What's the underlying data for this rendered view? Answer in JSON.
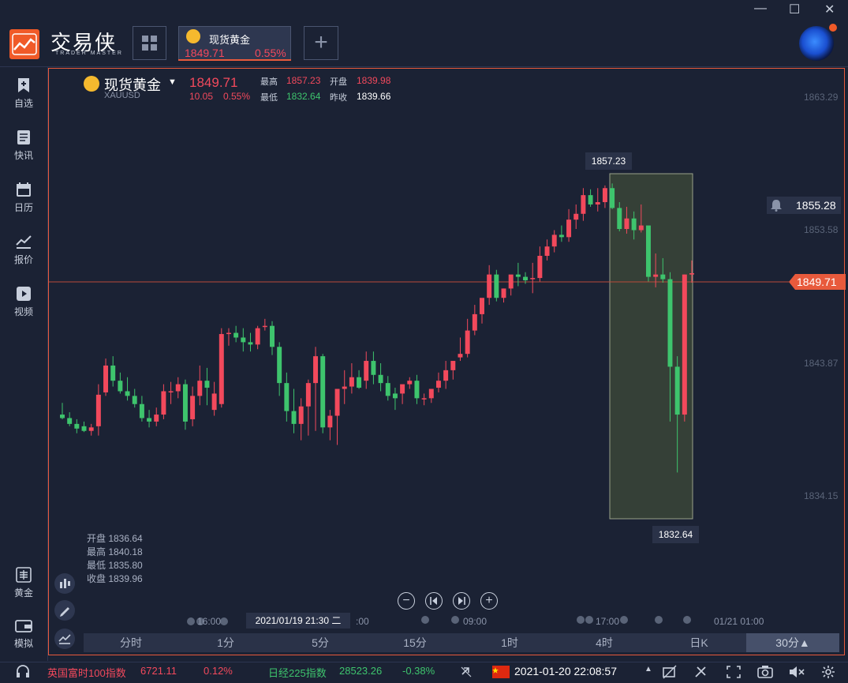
{
  "app": {
    "name": "交易侠",
    "sub": "TRADER MASTER"
  },
  "tab": {
    "name": "现货黄金",
    "price": "1849.71",
    "pct": "0.55%"
  },
  "window_controls": [
    "—",
    "☐",
    "✕"
  ],
  "sidebar": [
    {
      "label": "自选",
      "icon": "bookmark-plus-icon"
    },
    {
      "label": "快讯",
      "icon": "news-icon"
    },
    {
      "label": "日历",
      "icon": "calendar-icon"
    },
    {
      "label": "报价",
      "icon": "quote-chart-icon"
    },
    {
      "label": "视频",
      "icon": "video-icon"
    },
    {
      "label": "黄金",
      "icon": "gold-icon"
    },
    {
      "label": "模拟",
      "icon": "wallet-icon"
    }
  ],
  "symbol": {
    "name": "现货黄金",
    "code": "XAUUSD",
    "price": "1849.71",
    "change": "10.05",
    "pct": "0.55%",
    "high_label": "最高",
    "high": "1857.23",
    "open_label": "开盘",
    "open": "1839.98",
    "low_label": "最低",
    "low": "1832.64",
    "prev_label": "昨收",
    "prev": "1839.66"
  },
  "ohlc_box": {
    "open": "开盘 1836.64",
    "high": "最高 1840.18",
    "low": "最低 1835.80",
    "close": "收盘 1839.96"
  },
  "price_axis": [
    "1863.29",
    "1853.58",
    "1843.87",
    "1834.15"
  ],
  "alert_price": "1855.28",
  "current_price": "1849.71",
  "range_high": "1857.23",
  "range_low": "1832.64",
  "time_labels": {
    "t1": "16:00",
    "cursor": "2021/01/19 21:30 二",
    "t2": ":00",
    "t3": "09:00",
    "t4": "17:00",
    "t5": "01/21 01:00"
  },
  "timeframes": [
    "分时",
    "1分",
    "5分",
    "15分",
    "1时",
    "4时",
    "日K",
    "30分▲"
  ],
  "active_timeframe": "30分▲",
  "status": {
    "idx1_name": "英国富时100指数",
    "idx1_val": "6721.11",
    "idx1_pct": "0.12%",
    "idx2_name": "日经225指数",
    "idx2_val": "28523.26",
    "idx2_pct": "-0.38%",
    "datetime": "2021-01-20 22:08:57"
  },
  "colors": {
    "up": "#f2495c",
    "down": "#3ec46d",
    "accent": "#e85a3c",
    "bg": "#1b2234"
  },
  "chart_data": {
    "type": "candlestick",
    "ylim": [
      1830.5,
      1865.0
    ],
    "candles": [
      [
        1837.6,
        1838.6,
        1837.2,
        1837.3
      ],
      [
        1837.3,
        1837.8,
        1836.6,
        1836.8
      ],
      [
        1836.8,
        1837.2,
        1836.0,
        1836.4
      ],
      [
        1836.6,
        1837.0,
        1836.1,
        1836.2
      ],
      [
        1836.2,
        1836.8,
        1835.8,
        1836.5
      ],
      [
        1836.6,
        1840.2,
        1835.8,
        1839.3
      ],
      [
        1839.5,
        1842.4,
        1839.2,
        1841.8
      ],
      [
        1841.8,
        1842.6,
        1840.0,
        1840.5
      ],
      [
        1840.5,
        1841.2,
        1839.4,
        1839.6
      ],
      [
        1839.6,
        1840.8,
        1838.8,
        1839.2
      ],
      [
        1839.2,
        1839.8,
        1838.2,
        1838.5
      ],
      [
        1838.5,
        1839.2,
        1837.0,
        1837.3
      ],
      [
        1837.3,
        1838.0,
        1836.5,
        1837.0
      ],
      [
        1837.0,
        1838.2,
        1836.6,
        1837.6
      ],
      [
        1837.6,
        1840.2,
        1837.2,
        1839.6
      ],
      [
        1839.6,
        1840.4,
        1838.5,
        1839.6
      ],
      [
        1839.6,
        1840.8,
        1839.0,
        1840.2
      ],
      [
        1840.2,
        1840.6,
        1836.3,
        1837.0
      ],
      [
        1837.2,
        1840.0,
        1836.6,
        1839.2
      ],
      [
        1839.2,
        1841.8,
        1838.4,
        1840.5
      ],
      [
        1840.5,
        1841.6,
        1838.4,
        1839.9
      ],
      [
        1838.0,
        1840.4,
        1837.5,
        1839.4
      ],
      [
        1838.5,
        1845.0,
        1838.2,
        1844.5
      ],
      [
        1844.5,
        1845.0,
        1843.5,
        1844.6
      ],
      [
        1844.6,
        1845.2,
        1843.8,
        1844.2
      ],
      [
        1844.2,
        1845.0,
        1843.0,
        1843.8
      ],
      [
        1843.8,
        1844.6,
        1843.0,
        1843.6
      ],
      [
        1843.6,
        1845.2,
        1843.2,
        1845.0
      ],
      [
        1845.2,
        1845.8,
        1844.8,
        1845.2
      ],
      [
        1845.2,
        1845.6,
        1842.7,
        1843.4
      ],
      [
        1843.4,
        1843.8,
        1839.2,
        1840.3
      ],
      [
        1840.3,
        1841.2,
        1837.0,
        1837.9
      ],
      [
        1837.9,
        1839.8,
        1836.0,
        1836.8
      ],
      [
        1836.8,
        1839.0,
        1835.4,
        1838.3
      ],
      [
        1838.3,
        1840.6,
        1835.8,
        1840.3
      ],
      [
        1840.3,
        1843.4,
        1836.2,
        1842.6
      ],
      [
        1842.6,
        1842.8,
        1836.0,
        1836.5
      ],
      [
        1836.5,
        1838.0,
        1835.4,
        1837.5
      ],
      [
        1837.5,
        1839.6,
        1835.0,
        1839.8
      ],
      [
        1839.8,
        1841.4,
        1838.5,
        1840.0
      ],
      [
        1840.0,
        1842.0,
        1839.4,
        1840.8
      ],
      [
        1840.8,
        1841.4,
        1839.8,
        1839.9
      ],
      [
        1840.5,
        1843.0,
        1839.8,
        1842.2
      ],
      [
        1842.2,
        1843.0,
        1840.2,
        1841.0
      ],
      [
        1841.0,
        1842.0,
        1839.6,
        1840.3
      ],
      [
        1840.3,
        1840.9,
        1838.8,
        1839.2
      ],
      [
        1839.4,
        1839.9,
        1838.0,
        1839.0
      ],
      [
        1839.4,
        1840.0,
        1838.5,
        1840.2
      ],
      [
        1840.2,
        1840.8,
        1839.8,
        1840.5
      ],
      [
        1840.5,
        1841.0,
        1838.5,
        1839.0
      ],
      [
        1839.0,
        1839.4,
        1838.4,
        1839.0
      ],
      [
        1839.0,
        1839.8,
        1838.6,
        1839.8
      ],
      [
        1839.9,
        1841.2,
        1839.5,
        1840.5
      ],
      [
        1840.5,
        1842.2,
        1839.8,
        1841.4
      ],
      [
        1841.4,
        1842.0,
        1840.6,
        1842.2
      ],
      [
        1842.5,
        1844.2,
        1842.2,
        1842.8
      ],
      [
        1842.8,
        1845.8,
        1842.5,
        1844.8
      ],
      [
        1844.8,
        1847.0,
        1844.4,
        1846.2
      ],
      [
        1846.2,
        1847.2,
        1845.4,
        1847.6
      ],
      [
        1847.6,
        1850.4,
        1847.0,
        1849.6
      ],
      [
        1849.6,
        1850.0,
        1847.3,
        1847.6
      ],
      [
        1847.6,
        1848.4,
        1847.2,
        1848.4
      ],
      [
        1848.4,
        1849.4,
        1847.8,
        1849.6
      ],
      [
        1849.6,
        1850.6,
        1848.6,
        1849.4
      ],
      [
        1849.4,
        1849.8,
        1848.8,
        1849.1
      ],
      [
        1849.2,
        1850.6,
        1848.0,
        1849.3
      ],
      [
        1849.3,
        1852.0,
        1849.0,
        1851.2
      ],
      [
        1851.2,
        1852.6,
        1850.8,
        1852.0
      ],
      [
        1852.0,
        1853.4,
        1851.5,
        1853.0
      ],
      [
        1853.0,
        1853.8,
        1852.4,
        1852.8
      ],
      [
        1852.8,
        1855.2,
        1852.4,
        1854.3
      ],
      [
        1854.3,
        1855.6,
        1853.5,
        1854.8
      ],
      [
        1854.8,
        1857.0,
        1854.2,
        1856.4
      ],
      [
        1856.4,
        1856.9,
        1855.4,
        1855.6
      ],
      [
        1855.6,
        1857.0,
        1855.0,
        1855.8
      ],
      [
        1855.8,
        1857.23,
        1855.3,
        1857.0
      ],
      [
        1857.0,
        1857.4,
        1855.2,
        1855.3
      ],
      [
        1855.3,
        1855.8,
        1853.3,
        1853.5
      ],
      [
        1853.5,
        1855.4,
        1853.1,
        1854.4
      ],
      [
        1854.4,
        1855.0,
        1852.6,
        1853.4
      ],
      [
        1853.4,
        1855.6,
        1853.2,
        1853.8
      ],
      [
        1853.8,
        1852.0,
        1849.0,
        1849.4
      ],
      [
        1849.4,
        1851.4,
        1848.5,
        1849.6
      ],
      [
        1849.6,
        1851.0,
        1848.9,
        1849.2
      ],
      [
        1849.2,
        1849.8,
        1837.0,
        1841.7
      ],
      [
        1841.7,
        1842.6,
        1832.64,
        1837.6
      ],
      [
        1837.6,
        1849.6,
        1837.0,
        1849.6
      ],
      [
        1849.6,
        1850.8,
        1848.9,
        1849.71
      ]
    ]
  }
}
